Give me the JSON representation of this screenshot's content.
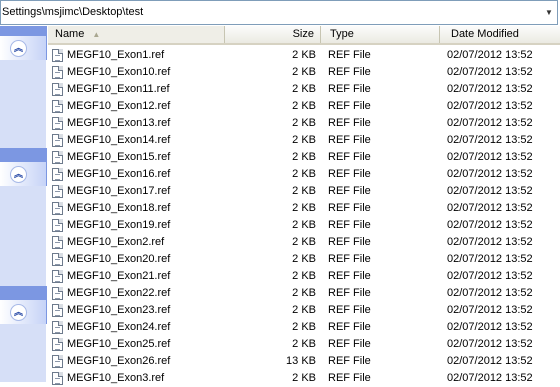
{
  "address_bar": {
    "path": "Settings\\msjimc\\Desktop\\test"
  },
  "task_pane": {
    "panels": [
      {
        "icon": "collapse-up-icon"
      },
      {
        "icon": "collapse-up-icon"
      },
      {
        "icon": "collapse-up-icon"
      }
    ]
  },
  "list": {
    "columns": {
      "name": "Name",
      "size": "Size",
      "type": "Type",
      "date": "Date Modified"
    },
    "sort_column": "name",
    "sort_direction": "ascending",
    "files": [
      {
        "name": "MEGF10_Exon1.ref",
        "size": "2 KB",
        "type": "REF File",
        "date": "02/07/2012 13:52"
      },
      {
        "name": "MEGF10_Exon10.ref",
        "size": "2 KB",
        "type": "REF File",
        "date": "02/07/2012 13:52"
      },
      {
        "name": "MEGF10_Exon11.ref",
        "size": "2 KB",
        "type": "REF File",
        "date": "02/07/2012 13:52"
      },
      {
        "name": "MEGF10_Exon12.ref",
        "size": "2 KB",
        "type": "REF File",
        "date": "02/07/2012 13:52"
      },
      {
        "name": "MEGF10_Exon13.ref",
        "size": "2 KB",
        "type": "REF File",
        "date": "02/07/2012 13:52"
      },
      {
        "name": "MEGF10_Exon14.ref",
        "size": "2 KB",
        "type": "REF File",
        "date": "02/07/2012 13:52"
      },
      {
        "name": "MEGF10_Exon15.ref",
        "size": "2 KB",
        "type": "REF File",
        "date": "02/07/2012 13:52"
      },
      {
        "name": "MEGF10_Exon16.ref",
        "size": "2 KB",
        "type": "REF File",
        "date": "02/07/2012 13:52"
      },
      {
        "name": "MEGF10_Exon17.ref",
        "size": "2 KB",
        "type": "REF File",
        "date": "02/07/2012 13:52"
      },
      {
        "name": "MEGF10_Exon18.ref",
        "size": "2 KB",
        "type": "REF File",
        "date": "02/07/2012 13:52"
      },
      {
        "name": "MEGF10_Exon19.ref",
        "size": "2 KB",
        "type": "REF File",
        "date": "02/07/2012 13:52"
      },
      {
        "name": "MEGF10_Exon2.ref",
        "size": "2 KB",
        "type": "REF File",
        "date": "02/07/2012 13:52"
      },
      {
        "name": "MEGF10_Exon20.ref",
        "size": "2 KB",
        "type": "REF File",
        "date": "02/07/2012 13:52"
      },
      {
        "name": "MEGF10_Exon21.ref",
        "size": "2 KB",
        "type": "REF File",
        "date": "02/07/2012 13:52"
      },
      {
        "name": "MEGF10_Exon22.ref",
        "size": "2 KB",
        "type": "REF File",
        "date": "02/07/2012 13:52"
      },
      {
        "name": "MEGF10_Exon23.ref",
        "size": "2 KB",
        "type": "REF File",
        "date": "02/07/2012 13:52"
      },
      {
        "name": "MEGF10_Exon24.ref",
        "size": "2 KB",
        "type": "REF File",
        "date": "02/07/2012 13:52"
      },
      {
        "name": "MEGF10_Exon25.ref",
        "size": "2 KB",
        "type": "REF File",
        "date": "02/07/2012 13:52"
      },
      {
        "name": "MEGF10_Exon26.ref",
        "size": "13 KB",
        "type": "REF File",
        "date": "02/07/2012 13:52"
      },
      {
        "name": "MEGF10_Exon3.ref",
        "size": "2 KB",
        "type": "REF File",
        "date": "02/07/2012 13:52"
      }
    ]
  }
}
